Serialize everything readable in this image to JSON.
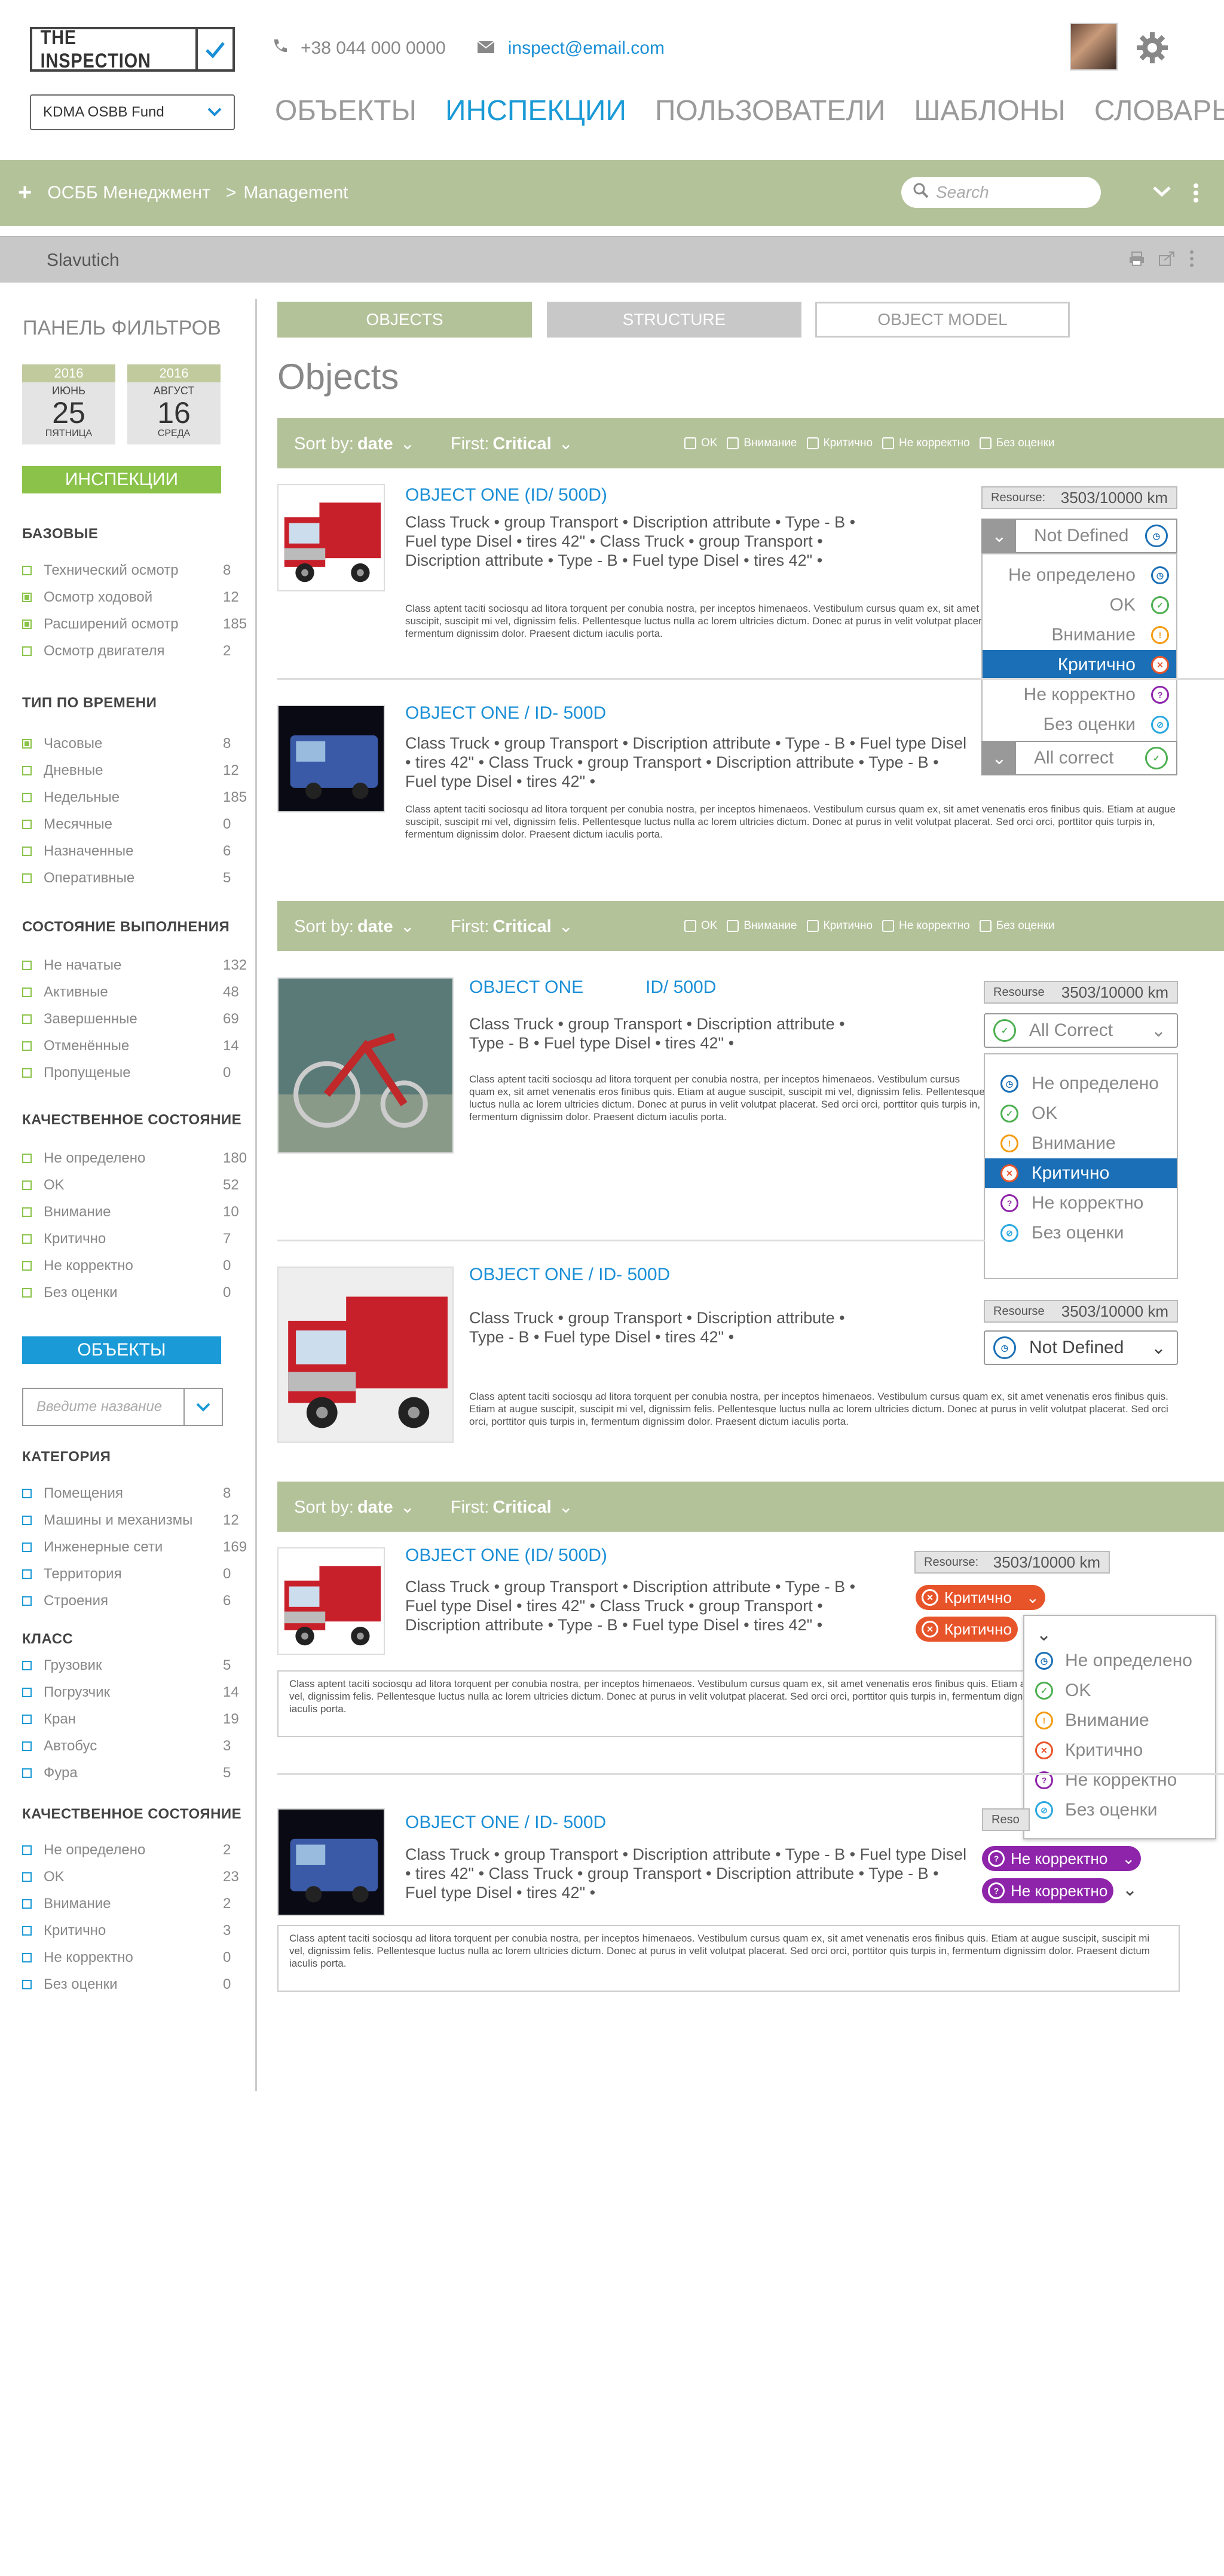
{
  "header": {
    "logo": "THE INSPECTION",
    "fund": "KDMA OSBB Fund",
    "phone": "+38 044 000 0000",
    "email": "inspect@email.com",
    "nav": [
      "ОБЪЕКТЫ",
      "ИНСПЕКЦИИ",
      "ПОЛЬЗОВАТЕЛИ",
      "ШАБЛОНЫ",
      "СЛОВАРЬ"
    ]
  },
  "breadcrumb": {
    "root": "ОСББ Менеджмент",
    "sep": ">",
    "current": "Management"
  },
  "search": {
    "placeholder": "Search"
  },
  "subbar": {
    "title": "Slavutich"
  },
  "sidebar": {
    "title": "ПАНЕЛЬ ФИЛЬТРОВ",
    "date1": {
      "year": "2016",
      "month": "ИЮНЬ",
      "day": "25",
      "weekday": "ПЯТНИЦА"
    },
    "date2": {
      "year": "2016",
      "month": "АВГУСТ",
      "day": "16",
      "weekday": "СРЕДА"
    },
    "btn_inspections": "ИНСПЕКЦИИ",
    "btn_objects": "ОБЪЕКТЫ",
    "input_placeholder": "Введите название",
    "groups": [
      {
        "title": "БАЗОВЫЕ",
        "items": [
          [
            "Технический осмотр",
            "8",
            false
          ],
          [
            "Осмотр ходовой",
            "12",
            true
          ],
          [
            "Расширений осмотр",
            "185",
            true
          ],
          [
            "Осмотр двигателя",
            "2",
            false
          ]
        ]
      },
      {
        "title": "ТИП ПО ВРЕМЕНИ",
        "items": [
          [
            "Часовые",
            "8",
            true
          ],
          [
            "Дневные",
            "12",
            false
          ],
          [
            "Недельные",
            "185",
            false
          ],
          [
            "Месячные",
            "0",
            false
          ],
          [
            "Назначенные",
            "6",
            false
          ],
          [
            "Оперативные",
            "5",
            false
          ]
        ]
      },
      {
        "title": "СОСТОЯНИЕ ВЫПОЛНЕНИЯ",
        "items": [
          [
            "Не начатые",
            "132",
            false
          ],
          [
            "Активные",
            "48",
            false
          ],
          [
            "Завершенные",
            "69",
            false
          ],
          [
            "Отменённые",
            "14",
            false
          ],
          [
            "Пропущеные",
            "0",
            false
          ]
        ]
      },
      {
        "title": "КАЧЕСТВЕННОЕ СОСТОЯНИЕ",
        "items": [
          [
            "Не определено",
            "180",
            false
          ],
          [
            "OK",
            "52",
            false
          ],
          [
            "Внимание",
            "10",
            false
          ],
          [
            "Критично",
            "7",
            false
          ],
          [
            "Не корректно",
            "0",
            false
          ],
          [
            "Без оценки",
            "0",
            false
          ]
        ]
      }
    ],
    "groups2": [
      {
        "title": "КАТЕГОРИЯ",
        "items": [
          [
            "Помещения",
            "8"
          ],
          [
            "Машины и механизмы",
            "12"
          ],
          [
            "Инженерные сети",
            "169"
          ],
          [
            "Территория",
            "0"
          ],
          [
            "Строения",
            "6"
          ]
        ]
      },
      {
        "title": "КЛАСС",
        "items": [
          [
            "Грузовик",
            "5"
          ],
          [
            "Погрузчик",
            "14"
          ],
          [
            "Кран",
            "19"
          ],
          [
            "Автобус",
            "3"
          ],
          [
            "Фура",
            "5"
          ]
        ]
      },
      {
        "title": "КАЧЕСТВЕННОЕ СОСТОЯНИЕ",
        "items": [
          [
            "Не определено",
            "2"
          ],
          [
            "OK",
            "23"
          ],
          [
            "Внимание",
            "2"
          ],
          [
            "Критично",
            "3"
          ],
          [
            "Не корректно",
            "0"
          ],
          [
            "Без оценки",
            "0"
          ]
        ]
      }
    ]
  },
  "tabs": [
    "OBJECTS",
    "STRUCTURE",
    "OBJECT MODEL"
  ],
  "main_title": "Objects",
  "sort": {
    "label": "Sort by:",
    "value": "date",
    "first_label": "First:",
    "first_value": "Critical",
    "checks": [
      "OK",
      "Внимание",
      "Критично",
      "Не корректно",
      "Без оценки"
    ]
  },
  "statuses": [
    "Не определено",
    "OK",
    "Внимание",
    "Критично",
    "Не корректно",
    "Без оценки"
  ],
  "status_colors": {
    "undef": "#1a6fb6",
    "ok": "#4caf50",
    "warn": "#f39c12",
    "crit": "#e8542a",
    "incorrect": "#8e24aa",
    "none": "#29a8e0"
  },
  "objects": [
    {
      "title": "OBJECT ONE (ID/ 500D)",
      "desc": "Class Truck • group Transport • Discription attribute • Type - B  •  Fuel type Disel • tires 42\"  •  Class Truck • group Transport •  Discription attribute • Type - B  •  Fuel type Disel •  tires 42\"  •",
      "lorem": "Class aptent taciti sociosqu ad litora torquent per conubia nostra, per inceptos himenaeos. Vestibulum cursus quam ex, sit amet venenatis eros finibus quis. Etiam at augue suscipit, suscipit mi vel, dignissim felis. Pellentesque luctus nulla ac lorem ultricies dictum. Donec at purus in velit volutpat placerat. Sed orci orci, porttitor quis turpis in, fermentum dignissim dolor. Praesent dictum iaculis porta.",
      "resource_label": "Resourse:",
      "resource": "3503/10000 km",
      "status": "Not Defined"
    },
    {
      "title": "OBJECT ONE / ID- 500D",
      "desc": "Class Truck • group Transport • Discription attribute • Type - B  •  Fuel type Disel •  tires 42\"  •  Class Truck • group Transport • Discription attribute • Type - B  •  Fuel type Disel • tires 42\"  •",
      "lorem": "Class aptent taciti sociosqu ad litora torquent per conubia nostra, per inceptos himenaeos. Vestibulum cursus quam ex, sit amet venenatis eros finibus quis. Etiam at augue suscipit, suscipit mi vel, dignissim felis. Pellentesque luctus nulla ac lorem ultricies dictum. Donec at purus in velit volutpat placerat. Sed orci orci, porttitor quis turpis in, fermentum dignissim dolor. Praesent dictum iaculis porta.",
      "status": "All correct"
    },
    {
      "title": "OBJECT ONE",
      "id": "ID/ 500D",
      "desc": "Class Truck • group Transport • Discription attribute •  Type - B  •  Fuel type Disel • tires 42\"  •",
      "lorem": "Class aptent taciti sociosqu ad litora torquent per conubia nostra, per inceptos himenaeos. Vestibulum cursus quam ex, sit amet venenatis eros finibus quis. Etiam at augue suscipit, suscipit mi vel, dignissim felis. Pellentesque luctus nulla ac lorem ultricies dictum. Donec at purus in velit volutpat placerat. Sed orci orci, porttitor quis turpis in, fermentum dignissim dolor. Praesent dictum iaculis porta.",
      "resource_label": "Resourse",
      "resource": "3503/10000 km",
      "status": "All Correct"
    },
    {
      "title": "OBJECT ONE / ID- 500D",
      "desc": "Class Truck • group Transport • Discription attribute •  Type - B  •  Fuel type Disel • tires 42\"  •",
      "lorem": "Class aptent taciti sociosqu ad litora torquent per conubia nostra, per inceptos himenaeos. Vestibulum cursus quam ex, sit amet venenatis eros finibus quis. Etiam at augue suscipit, suscipit mi vel, dignissim felis. Pellentesque luctus nulla ac lorem ultricies dictum. Donec at purus in velit volutpat placerat. Sed orci orci, porttitor quis turpis in, fermentum dignissim dolor. Praesent dictum iaculis porta.",
      "resource_label": "Resourse",
      "resource": "3503/10000 km",
      "status": "Not Defined"
    },
    {
      "title": "OBJECT ONE (ID/ 500D)",
      "desc": "Class Truck • group Transport • Discription attribute • Type - B  •  Fuel type Disel • tires 42\"  •  Class Truck • group Transport •  Discription attribute • Type - B  •  Fuel type Disel •  tires 42\"  •",
      "lorem": "Class aptent taciti sociosqu ad litora torquent per conubia nostra, per inceptos himenaeos. Vestibulum cursus quam ex, sit amet venenatis eros finibus quis. Etiam at augue suscipit, suscipit mi vel, dignissim felis. Pellentesque luctus nulla ac lorem ultricies dictum. Donec at purus in velit volutpat placerat. Sed orci orci, porttitor quis turpis in, fermentum dignissim dolor. Praesent dictum iaculis porta.",
      "resource_label": "Resourse:",
      "resource": "3503/10000 km",
      "status": "Критично"
    },
    {
      "title": "OBJECT ONE / ID- 500D",
      "desc": "Class Truck • group Transport • Discription attribute • Type - B  •  Fuel type Disel •  tires 42\"  •  Class Truck • group Transport • Discription attribute • Type - B  •  Fuel type Disel • tires 42\"  •",
      "lorem": "Class aptent taciti sociosqu ad litora torquent per conubia nostra, per inceptos himenaeos. Vestibulum cursus quam ex, sit amet venenatis eros finibus quis. Etiam at augue suscipit, suscipit mi vel, dignissim felis. Pellentesque luctus nulla ac lorem ultricies dictum. Donec at purus in velit volutpat placerat. Sed orci orci, porttitor quis turpis in, fermentum dignissim dolor. Praesent dictum iaculis porta.",
      "resource_label": "Reso",
      "status": "Не корректно"
    }
  ]
}
